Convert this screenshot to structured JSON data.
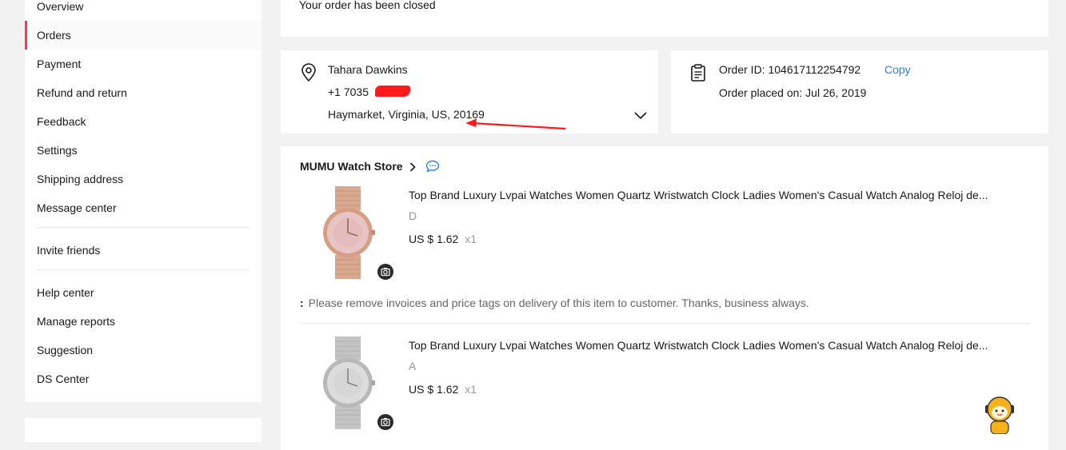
{
  "sidebar": {
    "items": [
      {
        "label": "Overview"
      },
      {
        "label": "Orders"
      },
      {
        "label": "Payment"
      },
      {
        "label": "Refund and return"
      },
      {
        "label": "Feedback"
      },
      {
        "label": "Settings"
      },
      {
        "label": "Shipping address"
      },
      {
        "label": "Message center"
      },
      {
        "label": "Invite friends"
      },
      {
        "label": "Help center"
      },
      {
        "label": "Manage reports"
      },
      {
        "label": "Suggestion"
      },
      {
        "label": "DS Center"
      }
    ],
    "active": "Orders"
  },
  "status": {
    "text": "Your order has been closed"
  },
  "address": {
    "name": "Tahara Dawkins",
    "phone": "+1 7035",
    "location": "Haymarket, Virginia, US, 20169"
  },
  "order": {
    "id_label": "Order ID: 104617112254792",
    "copy_label": "Copy",
    "placed_label": "Order placed on: Jul 26, 2019"
  },
  "store": {
    "name": "MUMU Watch Store",
    "products": [
      {
        "title": "Top Brand Luxury Lvpai Watches Women Quartz Wristwatch Clock Ladies Women's Casual Watch Analog Reloj de...",
        "variant": "D",
        "price": "US $ 1.62",
        "qty": "x1",
        "color": "rose-gold"
      },
      {
        "title": "Top Brand Luxury Lvpai Watches Women Quartz Wristwatch Clock Ladies Women's Casual Watch Analog Reloj de...",
        "variant": "A",
        "price": "US $ 1.62",
        "qty": "x1",
        "color": "silver"
      }
    ],
    "remark_colon": ":",
    "remark": "Please remove invoices and price tags on delivery of this item to customer. Thanks, business always."
  },
  "colors": {
    "accent": "#fd384f",
    "link": "#2e7df6",
    "annotation": "#ff1a1a"
  }
}
